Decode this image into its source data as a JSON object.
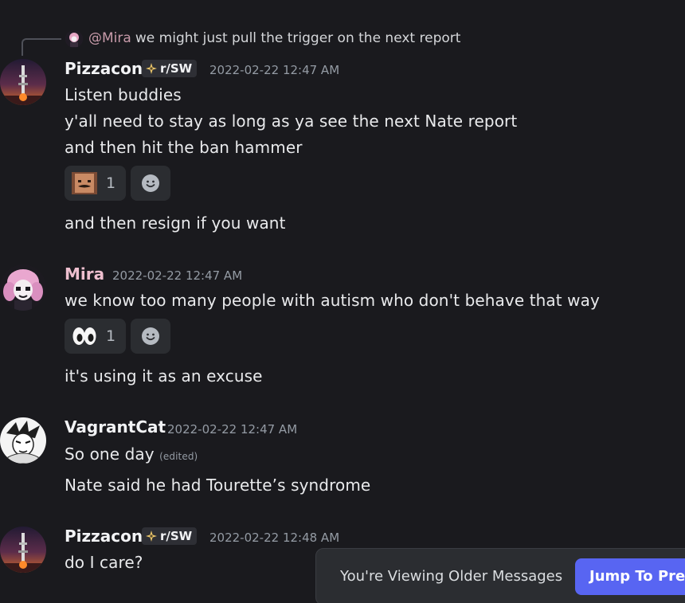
{
  "reply": {
    "author": "@Mira",
    "text": "we might just pull the trigger on the next report"
  },
  "messages": [
    {
      "author": "Pizzacon",
      "tag": "r/SW",
      "timestamp": "2022-02-22 12:47 AM",
      "lines": [
        "Listen buddies",
        "y'all need to stay as long as ya see the next Nate report",
        "and then hit the ban hammer"
      ],
      "reaction": {
        "emoji": "mustache-face-emoji",
        "count": "1"
      },
      "followup": "and then resign if you want"
    },
    {
      "author": "Mira",
      "timestamp": "2022-02-22 12:47 AM",
      "lines": [
        "we know too many people with autism who don't behave that way"
      ],
      "reaction": {
        "emoji": "eyes-emoji",
        "count": "1"
      },
      "followup": "it's using it as an excuse"
    },
    {
      "author": "VagrantCat",
      "timestamp": "2022-02-22 12:47 AM",
      "lines": [
        "So one day"
      ],
      "edited": "(edited)",
      "followup": "Nate said he had Tourette’s syndrome"
    },
    {
      "author": "Pizzacon",
      "tag": "r/SW",
      "timestamp": "2022-02-22 12:48 AM",
      "lines": [
        "do I care?"
      ]
    }
  ],
  "banner": {
    "text": "You're Viewing Older Messages",
    "button": "Jump To Present"
  },
  "colors": {
    "background": "#1a1a1e",
    "mira_name": "#eebfcf",
    "accent": "#5865f2"
  }
}
